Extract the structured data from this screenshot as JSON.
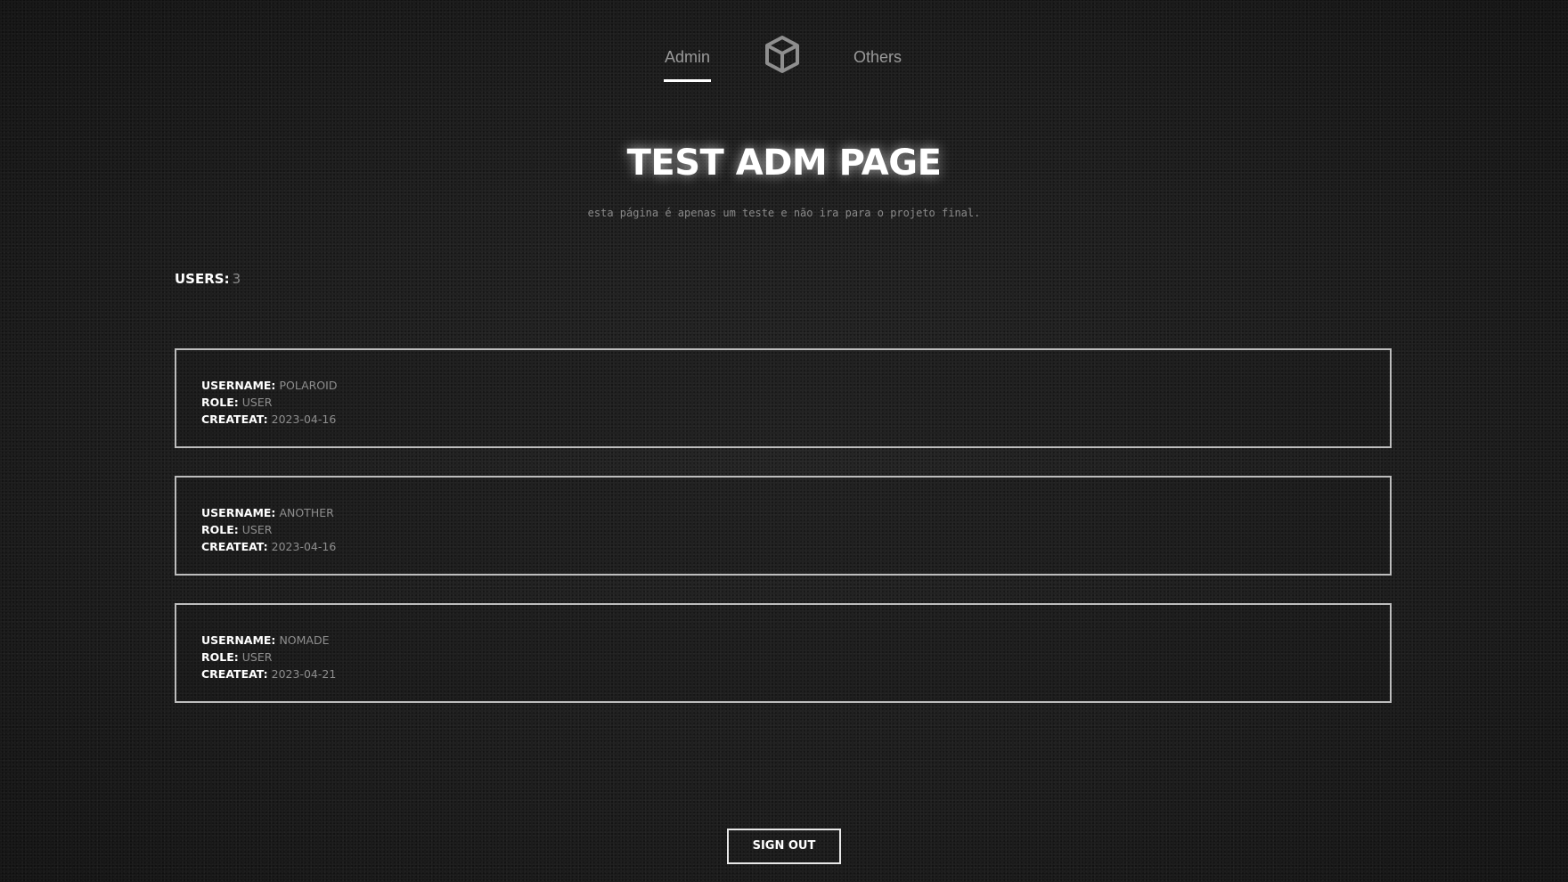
{
  "nav": {
    "left_tab": "Admin",
    "right_tab": "Others",
    "logo_icon": "cube-icon",
    "active_tab": "Admin"
  },
  "header": {
    "title": "TEST ADM PAGE",
    "subtitle": "esta página é apenas um teste e não ira para o projeto final."
  },
  "users": {
    "label": "USERS:",
    "count": "3"
  },
  "labels": {
    "username": "USERNAME:",
    "role": "ROLE:",
    "createat": "CREATEAT:"
  },
  "user_list": [
    {
      "username": "POLAROID",
      "role": "USER",
      "createat": "2023-04-16"
    },
    {
      "username": "ANOTHER",
      "role": "USER",
      "createat": "2023-04-16"
    },
    {
      "username": "NOMADE",
      "role": "USER",
      "createat": "2023-04-21"
    }
  ],
  "signout_label": "SIGN OUT",
  "colors": {
    "background": "#1e1e1e",
    "text_primary": "#ffffff",
    "text_muted": "#8e8e8e",
    "card_border": "#bdbdbd"
  }
}
